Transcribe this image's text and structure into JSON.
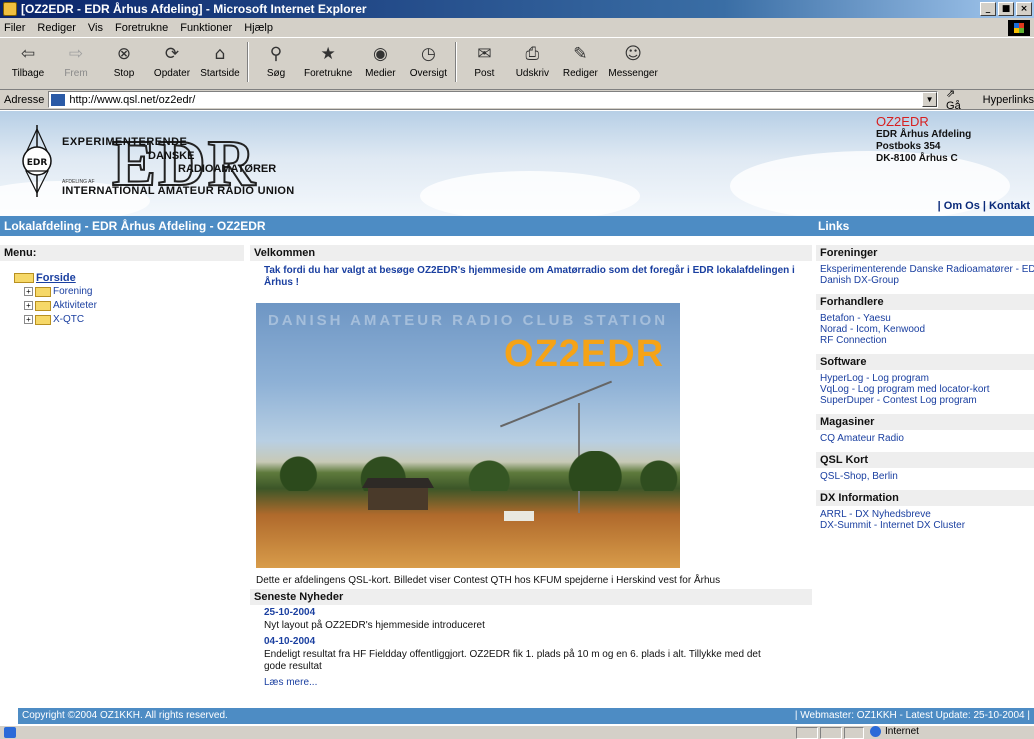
{
  "window": {
    "title": "[OZ2EDR - EDR Århus Afdeling] - Microsoft Internet Explorer",
    "controls": [
      "_",
      "■",
      "×"
    ]
  },
  "menubar": {
    "items": [
      "Filer",
      "Rediger",
      "Vis",
      "Foretrukne",
      "Funktioner",
      "Hjælp"
    ]
  },
  "toolbar": {
    "buttons": [
      {
        "label": "Tilbage",
        "icon": "back-arrow-icon",
        "glyph": "⇦"
      },
      {
        "label": "Frem",
        "icon": "forward-arrow-icon",
        "glyph": "⇨"
      },
      {
        "label": "Stop",
        "icon": "stop-icon",
        "glyph": "⊗"
      },
      {
        "label": "Opdater",
        "icon": "refresh-icon",
        "glyph": "⟳"
      },
      {
        "label": "Startside",
        "icon": "home-icon",
        "glyph": "⌂"
      },
      {
        "label": "Søg",
        "icon": "search-icon",
        "glyph": "⚲"
      },
      {
        "label": "Foretrukne",
        "icon": "favorites-icon",
        "glyph": "★"
      },
      {
        "label": "Medier",
        "icon": "media-icon",
        "glyph": "◉"
      },
      {
        "label": "Oversigt",
        "icon": "history-icon",
        "glyph": "◷"
      },
      {
        "label": "Post",
        "icon": "mail-icon",
        "glyph": "✉"
      },
      {
        "label": "Udskriv",
        "icon": "print-icon",
        "glyph": "⎙"
      },
      {
        "label": "Rediger",
        "icon": "edit-icon",
        "glyph": "✎"
      },
      {
        "label": "Messenger",
        "icon": "messenger-icon",
        "glyph": "☺"
      }
    ]
  },
  "addressbar": {
    "label": "Adresse",
    "url": "http://www.qsl.net/oz2edr/",
    "go_label": "Gå",
    "links_label": "Hyperlinks"
  },
  "banner": {
    "logo_letters": "EDR",
    "line1": "EXPERIMENTERENDE",
    "line2": "DANSKE",
    "line3": "RADIOAMATØRER",
    "line4": "AFDELING AF",
    "line5": "INTERNATIONAL AMATEUR RADIO UNION",
    "callsign": "OZ2EDR",
    "address": [
      "EDR Århus Afdeling",
      "Postboks 354",
      "DK-8100 Århus C"
    ],
    "links": [
      "| Om Os",
      "| Kontakt"
    ]
  },
  "headerbar": {
    "left": "Lokalafdeling - EDR Århus Afdeling - OZ2EDR",
    "right": "Links"
  },
  "menu": {
    "title": "Menu:",
    "root": "Forside",
    "items": [
      "Forening",
      "Aktiviteter",
      "X-QTC"
    ]
  },
  "main": {
    "title": "Velkommen",
    "intro": "Tak fordi du har valgt at besøge OZ2EDR's hjemmeside om Amatørradio som det foregår i EDR lokalafdelingen i Århus !",
    "photo_top_text": "DANISH AMATEUR RADIO CLUB STATION",
    "photo_callsign": "OZ2EDR",
    "photo_caption": "Dette er afdelingens QSL-kort. Billedet viser Contest QTH hos KFUM spejderne i Herskind vest for Århus",
    "news_title": "Seneste Nyheder",
    "news": [
      {
        "date": "25-10-2004",
        "text": "Nyt layout på OZ2EDR's hjemmeside introduceret"
      },
      {
        "date": "04-10-2004",
        "text": "Endeligt resultat fra HF Fieldday offentliggjort. OZ2EDR fik 1. plads på 10 m og en 6. plads i alt. Tillykke med det gode resultat"
      }
    ],
    "more": "Læs mere..."
  },
  "links": {
    "sections": [
      {
        "title": "Foreninger",
        "items": [
          "Eksperimenterende Danske Radioamatører - EDR",
          "Danish DX-Group"
        ]
      },
      {
        "title": "Forhandlere",
        "items": [
          "Betafon - Yaesu",
          "Norad - Icom, Kenwood",
          "RF Connection"
        ]
      },
      {
        "title": "Software",
        "items": [
          "HyperLog - Log program",
          "VqLog - Log program med locator-kort",
          "SuperDuper - Contest Log program"
        ]
      },
      {
        "title": "Magasiner",
        "items": [
          "CQ Amateur Radio"
        ]
      },
      {
        "title": "QSL Kort",
        "items": [
          "QSL-Shop, Berlin"
        ]
      },
      {
        "title": "DX Information",
        "items": [
          "ARRL - DX Nyhedsbreve",
          "DX-Summit - Internet DX Cluster"
        ]
      }
    ]
  },
  "footer": {
    "left": "Copyright ©2004 OZ1KKH. All rights reserved.",
    "right": "| Webmaster: OZ1KKH - Latest Update: 25-10-2004 |"
  },
  "statusbar": {
    "zone": "Internet"
  }
}
